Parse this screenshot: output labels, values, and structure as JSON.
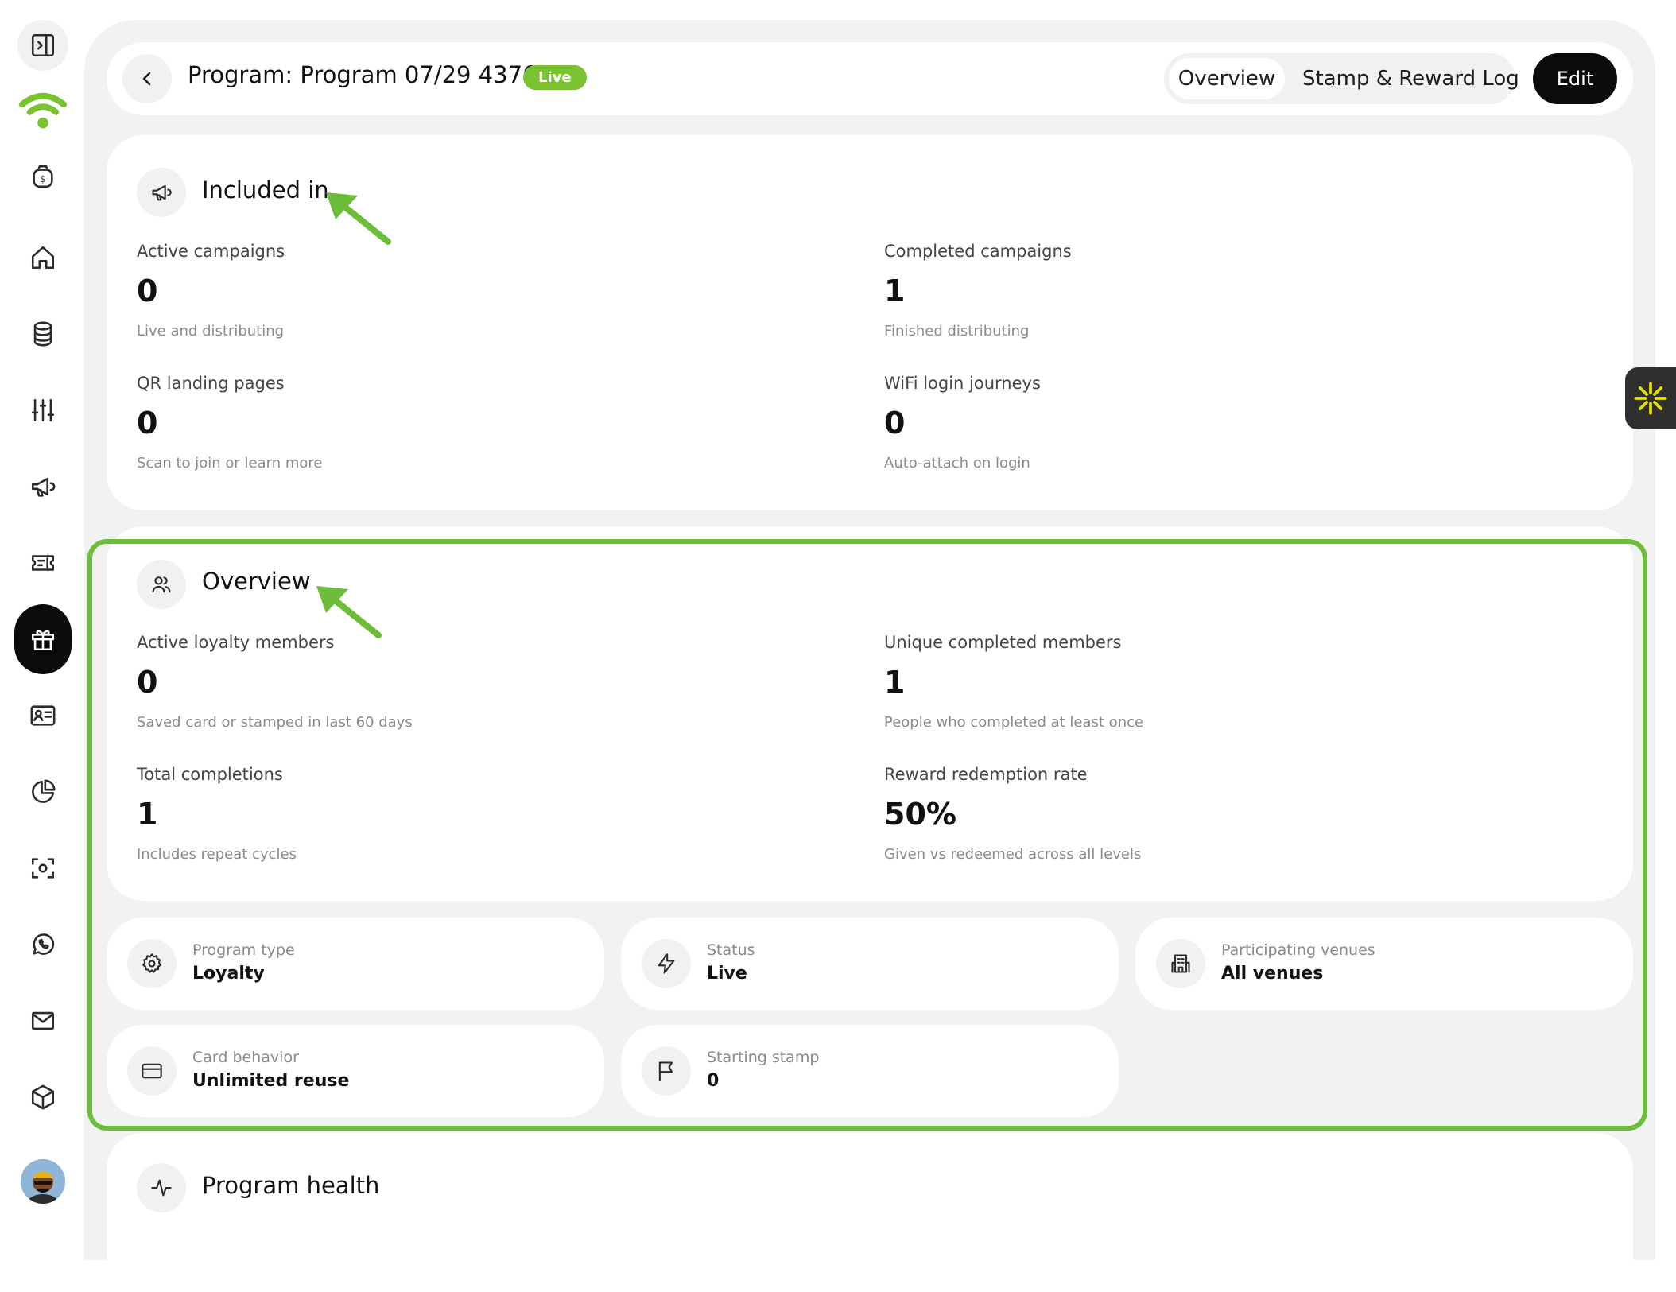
{
  "colors": {
    "accent_green": "#79c230",
    "highlight_green": "#6cbe3a",
    "dark": "#0b0b0b"
  },
  "sidebar": {
    "items": [
      {
        "icon": "panel-toggle-icon"
      },
      {
        "icon": "wifi-brand-icon"
      },
      {
        "icon": "money-bag-icon"
      },
      {
        "icon": "home-icon"
      },
      {
        "icon": "database-icon"
      },
      {
        "icon": "sliders-icon"
      },
      {
        "icon": "megaphone-icon"
      },
      {
        "icon": "ticket-icon"
      },
      {
        "icon": "gift-icon",
        "active": true
      },
      {
        "icon": "contact-card-icon"
      },
      {
        "icon": "pie-chart-icon"
      },
      {
        "icon": "scan-icon"
      },
      {
        "icon": "whatsapp-icon"
      },
      {
        "icon": "mail-icon"
      },
      {
        "icon": "box-icon"
      }
    ]
  },
  "header": {
    "title": "Program: Program 07/29 4376",
    "status_badge": "Live",
    "tabs": [
      {
        "label": "Overview",
        "active": true
      },
      {
        "label": "Stamp & Reward Log",
        "active": false
      }
    ],
    "edit_label": "Edit"
  },
  "included_in": {
    "title": "Included in",
    "stats": [
      {
        "label": "Active campaigns",
        "value": "0",
        "sub": "Live and distributing"
      },
      {
        "label": "Completed campaigns",
        "value": "1",
        "sub": "Finished distributing"
      },
      {
        "label": "QR landing pages",
        "value": "0",
        "sub": "Scan to join or learn more"
      },
      {
        "label": "WiFi login journeys",
        "value": "0",
        "sub": "Auto-attach on login"
      }
    ]
  },
  "overview": {
    "title": "Overview",
    "stats": [
      {
        "label": "Active loyalty members",
        "value": "0",
        "sub": "Saved card or stamped in last 60 days"
      },
      {
        "label": "Unique completed members",
        "value": "1",
        "sub": "People who completed at least once"
      },
      {
        "label": "Total completions",
        "value": "1",
        "sub": "Includes repeat cycles"
      },
      {
        "label": "Reward redemption rate",
        "value": "50%",
        "sub": "Given vs redeemed across all levels"
      }
    ]
  },
  "details": [
    {
      "icon": "gear-icon",
      "label": "Program type",
      "value": "Loyalty"
    },
    {
      "icon": "lightning-icon",
      "label": "Status",
      "value": "Live"
    },
    {
      "icon": "building-icon",
      "label": "Participating venues",
      "value": "All venues"
    },
    {
      "icon": "credit-card-icon",
      "label": "Card behavior",
      "value": "Unlimited reuse"
    },
    {
      "icon": "flag-icon",
      "label": "Starting stamp",
      "value": "0"
    }
  ],
  "program_health": {
    "title": "Program health"
  }
}
